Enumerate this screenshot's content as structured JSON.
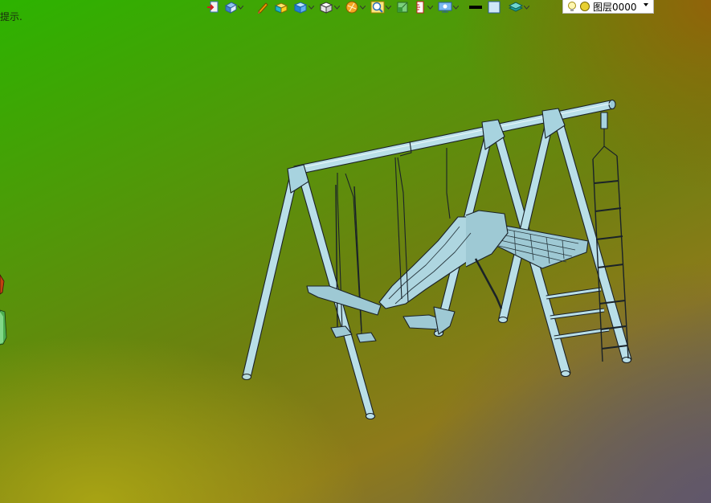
{
  "viewport": {
    "hint_text": "提示.",
    "background_colors": [
      "#2cb300",
      "#6e8010",
      "#9a6a0c",
      "#5e5868"
    ]
  },
  "toolbar": {
    "buttons": [
      {
        "name": "exit-sketch-icon",
        "has_dropdown": false
      },
      {
        "name": "view-orientation-icon",
        "has_dropdown": true
      },
      {
        "name": "pencil-icon",
        "has_dropdown": false
      },
      {
        "name": "shaded-box-icon",
        "has_dropdown": false
      },
      {
        "name": "display-style-icon",
        "has_dropdown": true
      },
      {
        "name": "hide-show-icon",
        "has_dropdown": true
      },
      {
        "name": "appearance-icon",
        "has_dropdown": true
      },
      {
        "name": "zoom-icon",
        "has_dropdown": true
      },
      {
        "name": "section-view-icon",
        "has_dropdown": false
      },
      {
        "name": "ruler-icon",
        "has_dropdown": true
      },
      {
        "name": "monitor-icon",
        "has_dropdown": true
      },
      {
        "name": "line-color-icon",
        "has_dropdown": false
      },
      {
        "name": "fill-color-icon",
        "has_dropdown": false
      },
      {
        "name": "layer-icon",
        "has_dropdown": true
      }
    ],
    "layer": {
      "name": "图层0000",
      "accent": "#e8d030"
    }
  },
  "model": {
    "description_icon": "swing-set-model",
    "line_color": "#1a2228",
    "fill_color": "#b9dfe8"
  }
}
